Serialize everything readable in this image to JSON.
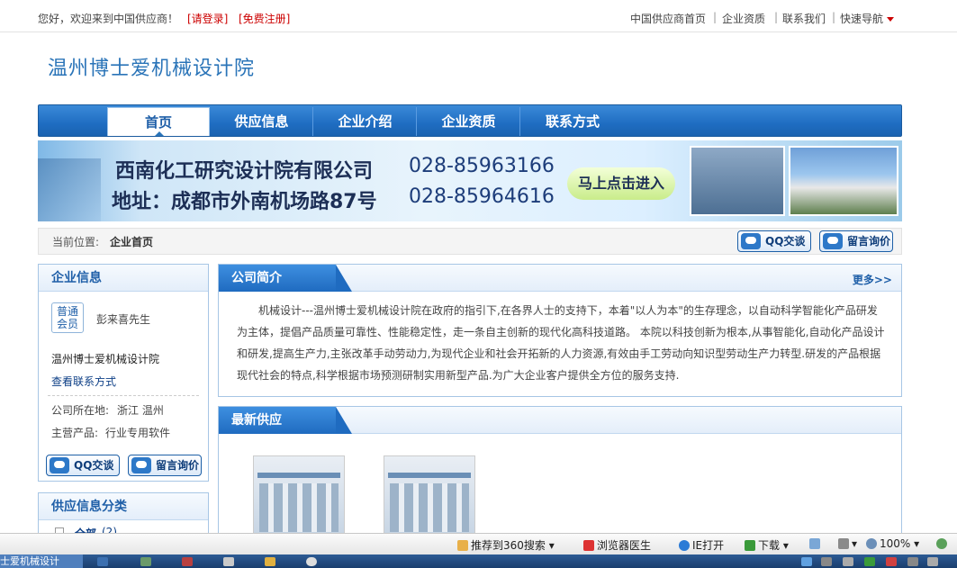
{
  "topbar": {
    "welcome": "您好，欢迎来到中国供应商！",
    "login": "[请登录]",
    "register": "[免费注册]",
    "links": [
      "中国供应商首页",
      "企业资质",
      "联系我们",
      "快速导航"
    ]
  },
  "site": {
    "title": "温州博士爱机械设计院"
  },
  "nav": {
    "items": [
      "首页",
      "供应信息",
      "企业介绍",
      "企业资质",
      "联系方式"
    ],
    "active": "首页"
  },
  "banner": {
    "line1": "西南化工研究设计院有限公司",
    "phone1": "028-85963166",
    "line2": "地址：成都市外南机场路87号",
    "phone2": "028-85964616",
    "button": "马上点击进入"
  },
  "breadcrumb": {
    "label": "当前位置:",
    "current": "企业首页"
  },
  "actions": {
    "qq": "QQ交谈",
    "message": "留言询价"
  },
  "company_info": {
    "heading": "企业信息",
    "member_badge": "普通\n会员",
    "contact_person": "彭来喜先生",
    "company_name": "温州博士爱机械设计院",
    "contact_link": "查看联系方式",
    "location_label": "公司所在地:",
    "location": "浙江 温州",
    "product_label": "主营产品:",
    "product": "行业专用软件"
  },
  "category": {
    "heading": "供应信息分类",
    "first_item": "全部",
    "first_count": "(2)"
  },
  "intro": {
    "heading": "公司简介",
    "more": "更多>>",
    "text": "机械设计---温州博士爱机械设计院在政府的指引下,在各界人士的支持下，本着\"以人为本\"的生存理念，以自动科学智能化产品研发为主体，提倡产品质量可靠性、性能稳定性，走一条自主创新的现代化高科技道路。 本院以科技创新为根本,从事智能化,自动化产品设计和研发,提高生产力,主张改革手动劳动力,为现代企业和社会开拓新的人力资源,有效由手工劳动向知识型劳动生产力转型.研发的产品根据现代社会的特点,科学根据市场预测研制实用新型产品.为广大企业客户提供全方位的服务支持."
  },
  "latest": {
    "heading": "最新供应"
  },
  "statusbar": {
    "recommend": "推荐到360搜索",
    "doctor": "浏览器医生",
    "ie_open": "IE打开",
    "download": "下载",
    "zoom": "100%"
  },
  "taskbar": {
    "window_title": "士爱机械设计"
  }
}
